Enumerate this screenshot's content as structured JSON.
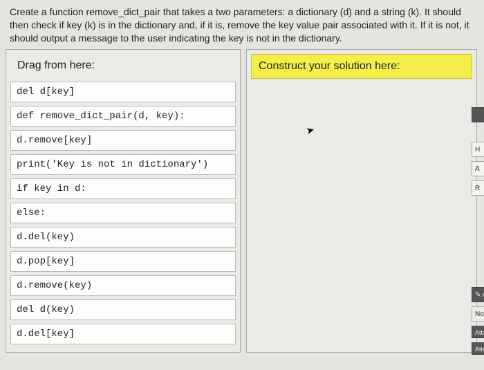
{
  "instructions": "Create a function remove_dict_pair that takes a two parameters: a dictionary (d) and a string (k). It should then check if key (k) is in the dictionary and, if it is, remove the key value pair associated with it. If it is not, it should output a message to the user indicating the key is not in the dictionary.",
  "left": {
    "header": "Drag from here:",
    "blocks": [
      "del d[key]",
      "def remove_dict_pair(d, key):",
      "d.remove[key]",
      "print('Key is not in dictionary')",
      "if key in d:",
      "else:",
      "d.del(key)",
      "d.pop[key]",
      "d.remove(key)",
      "del d(key)",
      "d.del[key]"
    ]
  },
  "right": {
    "header": "Construct your solution here:"
  },
  "side": {
    "b1": "H",
    "b2": "A",
    "b3": "R",
    "att": "✎ Att",
    "noatt": "No att",
    "attach1": "Attach a",
    "attach2": "Attach t"
  }
}
